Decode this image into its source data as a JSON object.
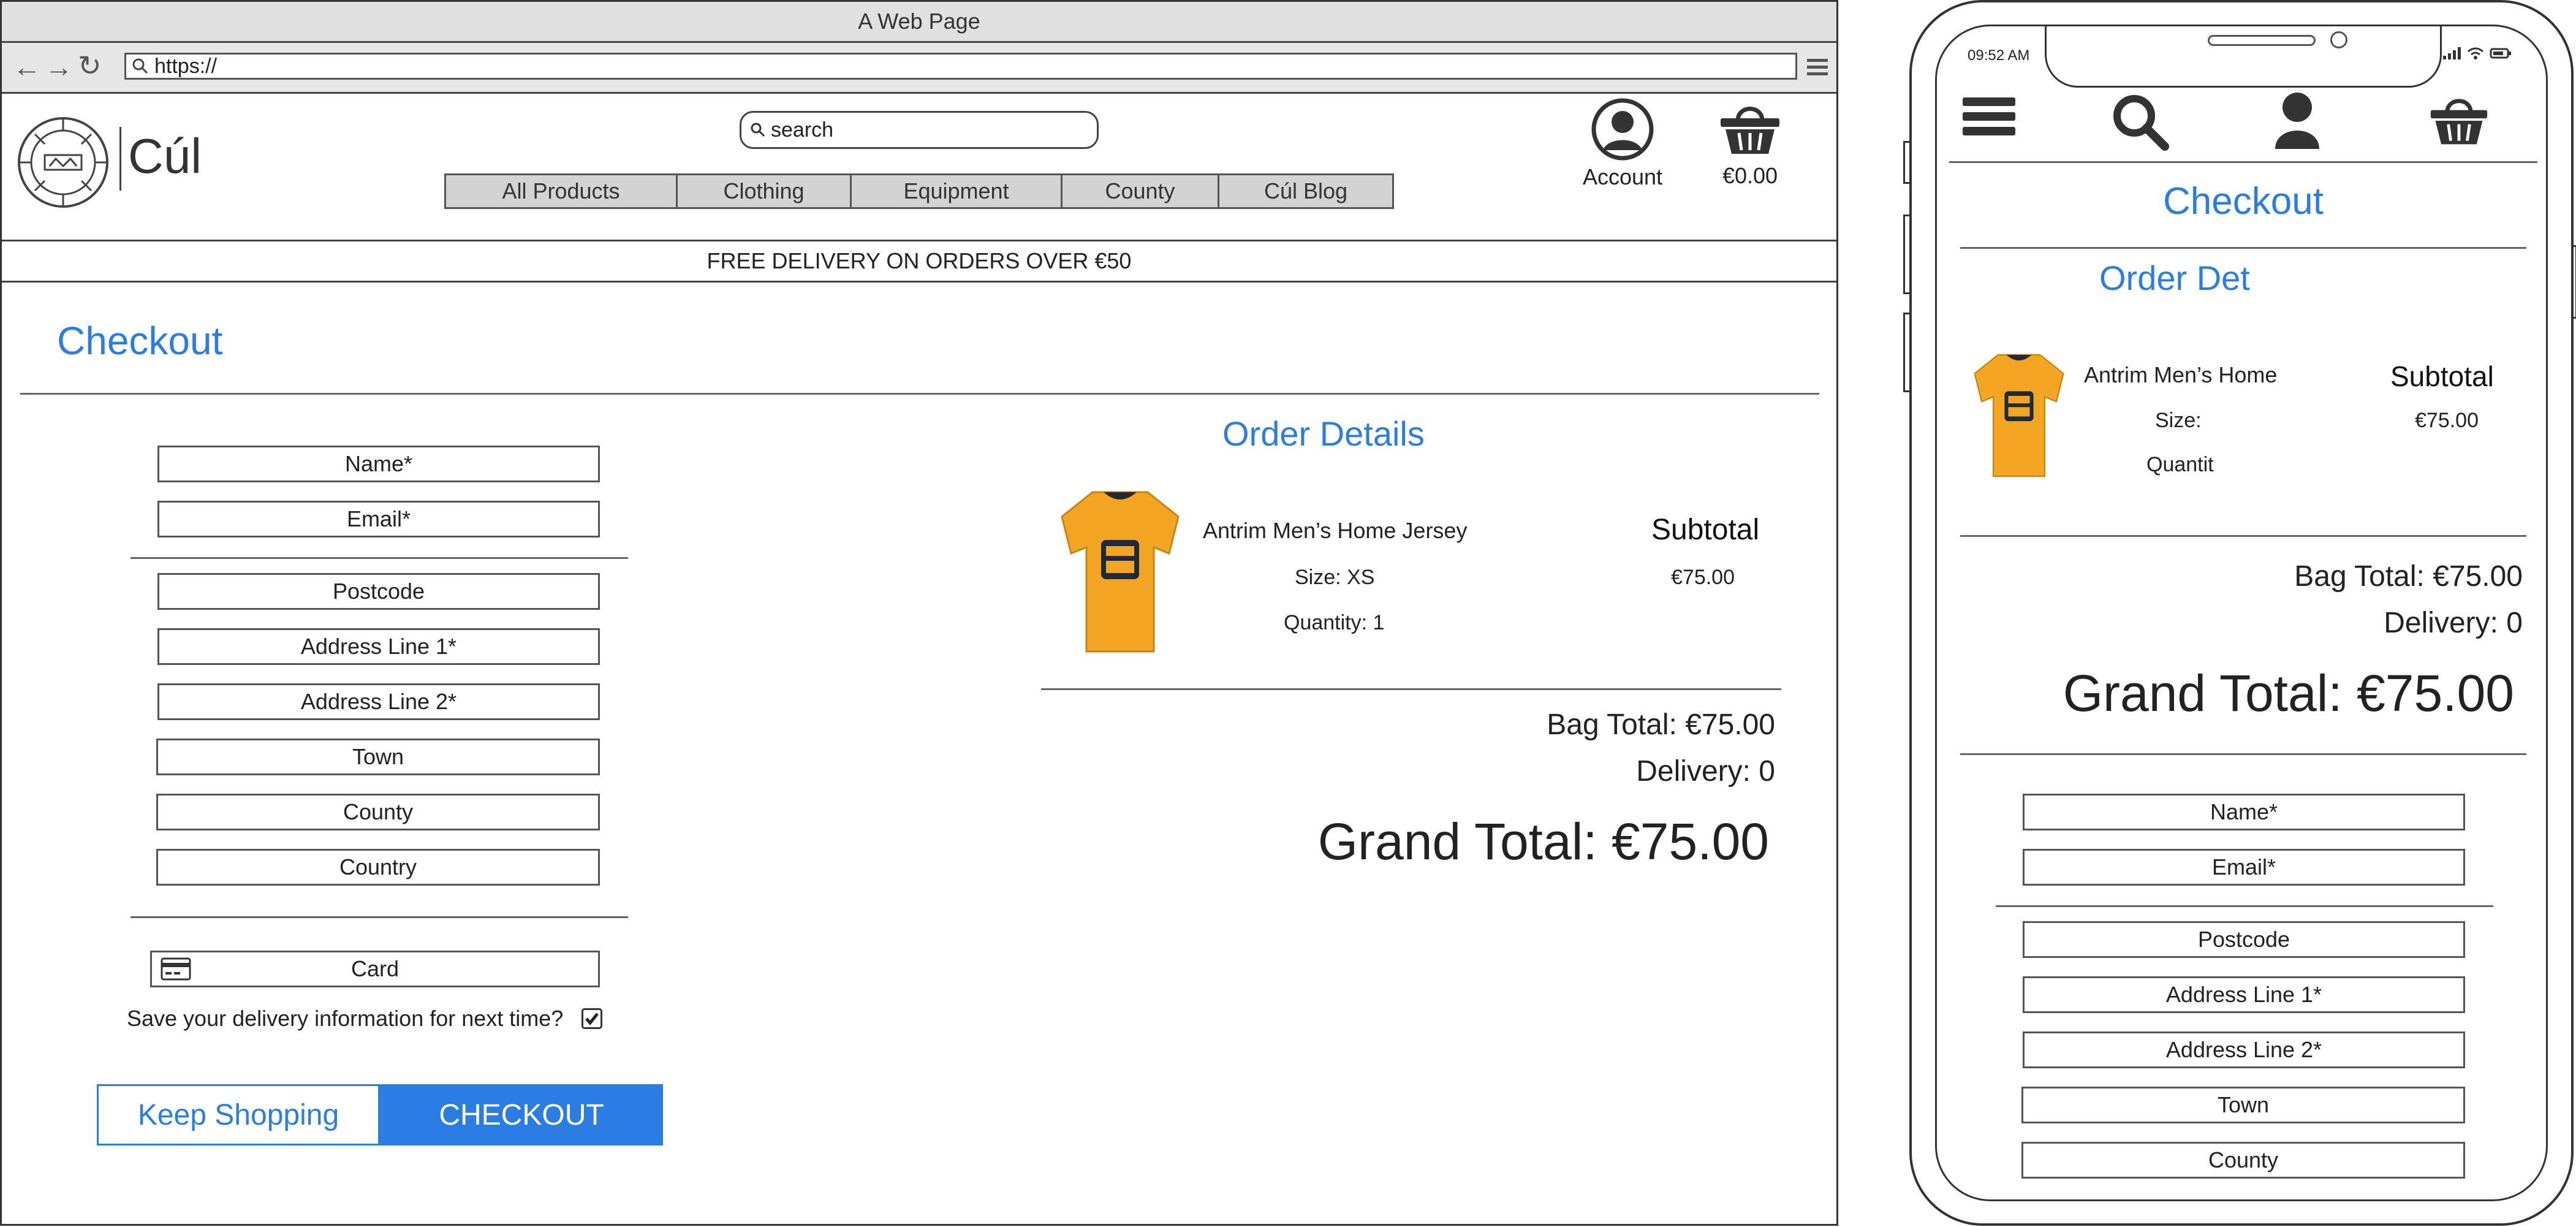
{
  "browser": {
    "title": "A Web Page",
    "url": "https://"
  },
  "site": {
    "brand": "Cúl",
    "search_placeholder": "search",
    "nav": [
      "All Products",
      "Clothing",
      "Equipment",
      "County",
      "Cúl Blog"
    ],
    "account_label": "Account",
    "cart_total": "€0.00",
    "banner": "FREE DELIVERY ON ORDERS OVER €50"
  },
  "desktop": {
    "page_title": "Checkout",
    "fields_personal": [
      "Name*",
      "Email*"
    ],
    "fields_address": [
      "Postcode",
      "Address Line 1*",
      "Address Line 2*",
      "Town",
      "County",
      "Country"
    ],
    "card_label": "Card",
    "save_info_label": "Save your delivery information for next time?",
    "save_info_checked": true,
    "keep_shopping": "Keep Shopping",
    "checkout": "CHECKOUT",
    "order": {
      "heading": "Order Details",
      "item_name": "Antrim Men’s Home Jersey",
      "size": "Size: XS",
      "quantity": "Quantity: 1",
      "subtotal_label": "Subtotal",
      "subtotal": "€75.00",
      "bag_total": "Bag Total: €75.00",
      "delivery": "Delivery: 0",
      "grand_total": "Grand Total: €75.00"
    }
  },
  "mobile": {
    "time": "09:52 AM",
    "page_title": "Checkout",
    "order_heading": "Order Det",
    "item_name": "Antrim Men’s Home",
    "size": "Size:",
    "quantity": "Quantit",
    "subtotal_label": "Subtotal",
    "subtotal": "€75.00",
    "bag_total": "Bag Total: €75.00",
    "delivery": "Delivery: 0",
    "grand_total": "Grand Total: €75.00",
    "fields_personal": [
      "Name*",
      "Email*"
    ],
    "fields_address": [
      "Postcode",
      "Address Line 1*",
      "Address Line 2*",
      "Town",
      "County"
    ]
  },
  "colors": {
    "accent": "#2b7de1",
    "jersey": "#f2a623",
    "jersey_dark": "#1f2a3a",
    "nav_bg": "#d3d3d3"
  }
}
